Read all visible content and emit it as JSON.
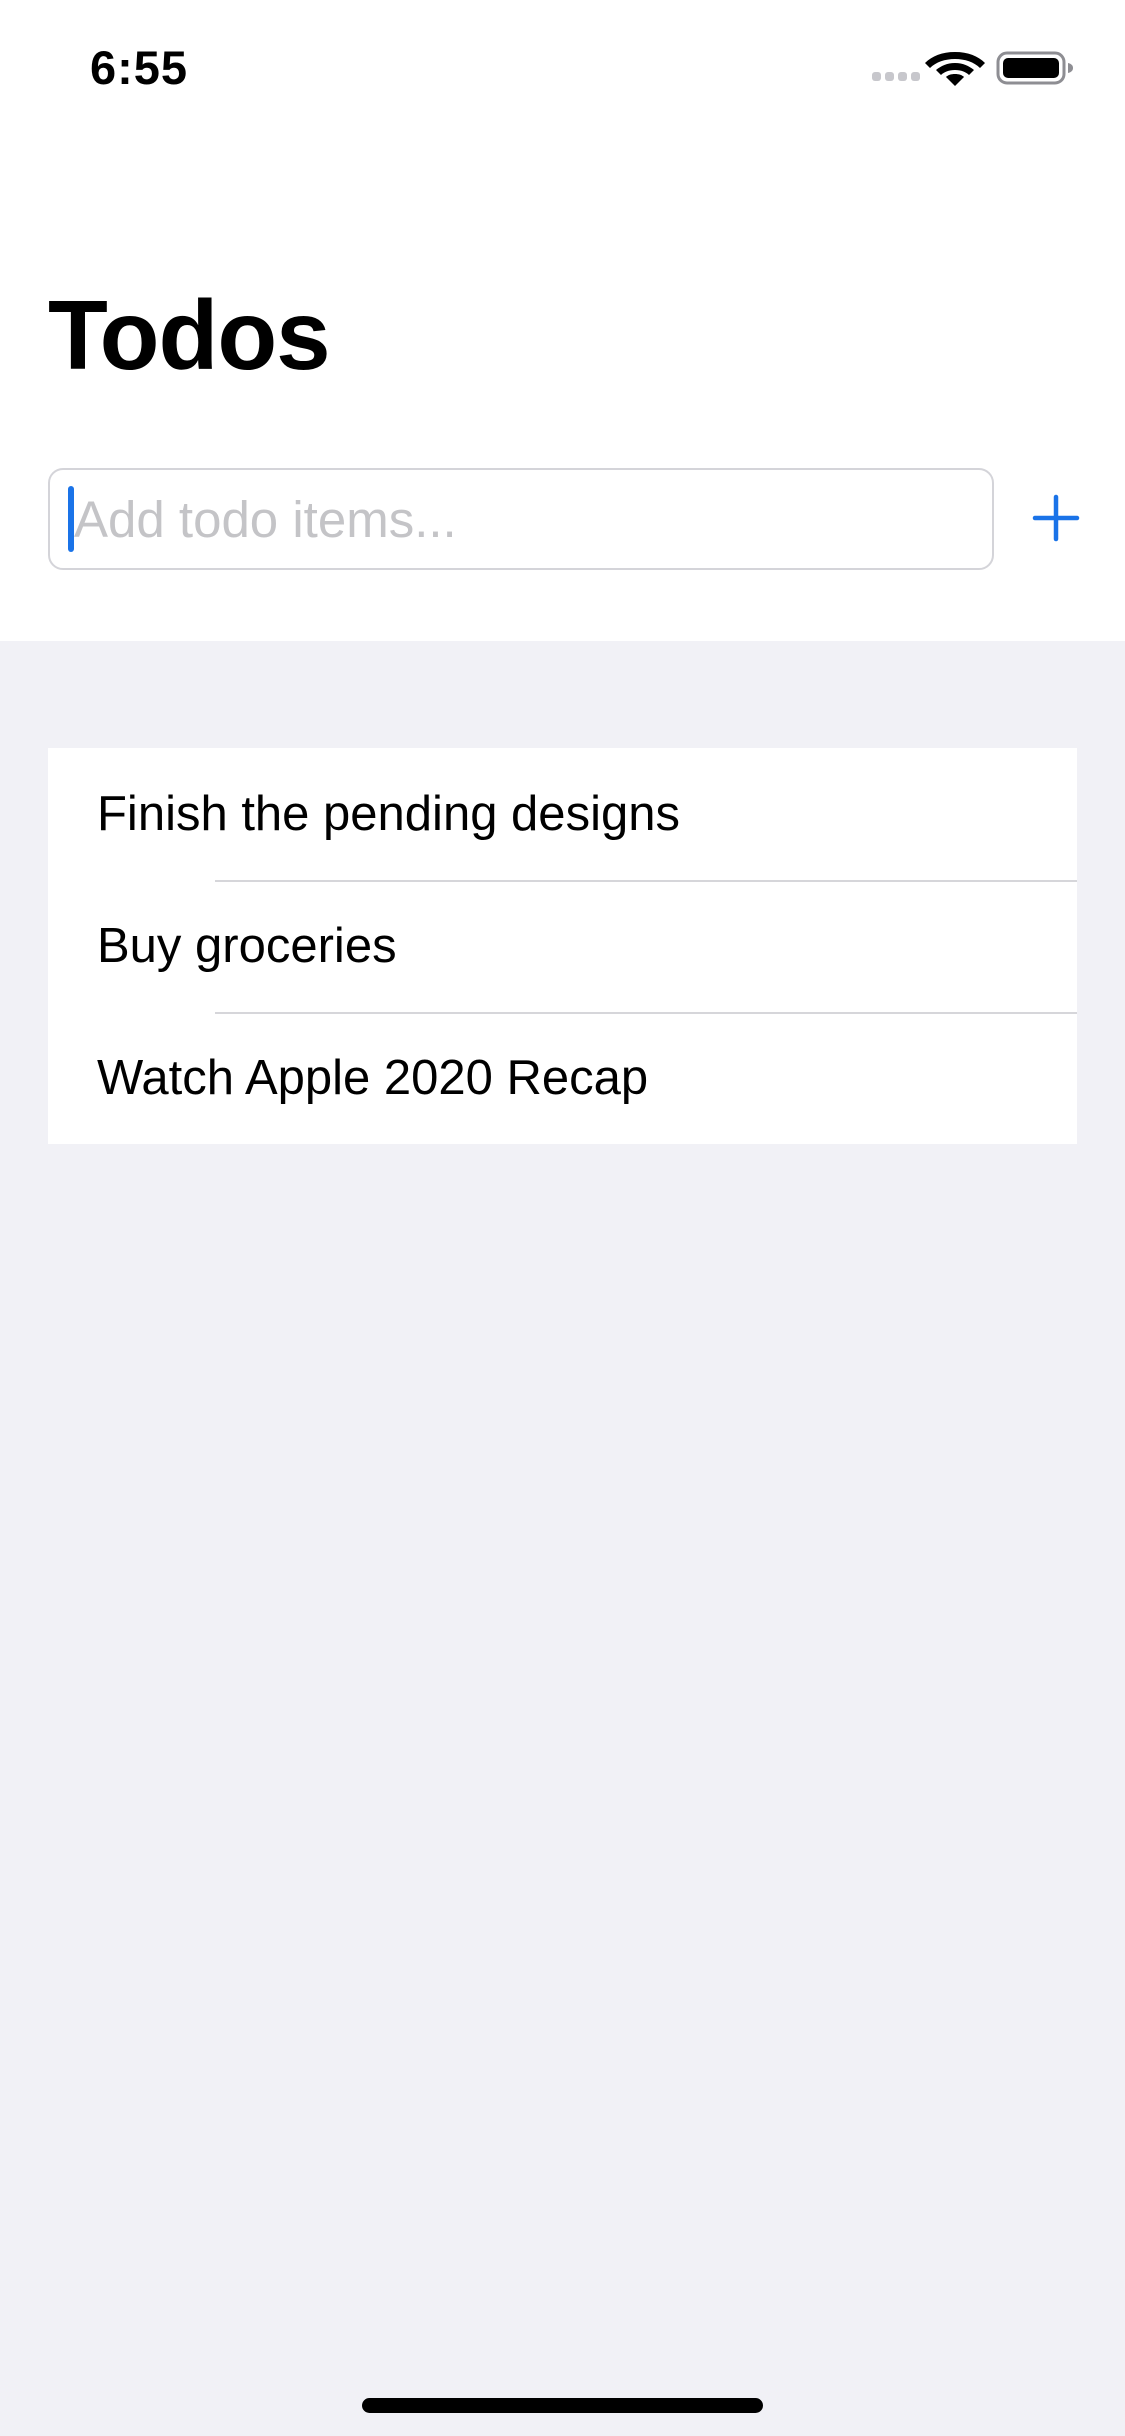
{
  "status_bar": {
    "time": "6:55",
    "icons": [
      "signal-icon",
      "wifi-icon",
      "battery-icon"
    ]
  },
  "header": {
    "title": "Todos"
  },
  "input": {
    "value": "",
    "placeholder": "Add todo items..."
  },
  "add_button": {
    "icon": "plus-icon"
  },
  "todos": [
    {
      "text": "Finish the pending designs"
    },
    {
      "text": "Buy groceries"
    },
    {
      "text": "Watch Apple 2020 Recap"
    }
  ],
  "colors": {
    "accent": "#1a73e8",
    "grouped_background": "#f1f1f6",
    "card_background": "#ffffff",
    "placeholder": "#c4c4c7",
    "separator": "#d6d6da"
  }
}
